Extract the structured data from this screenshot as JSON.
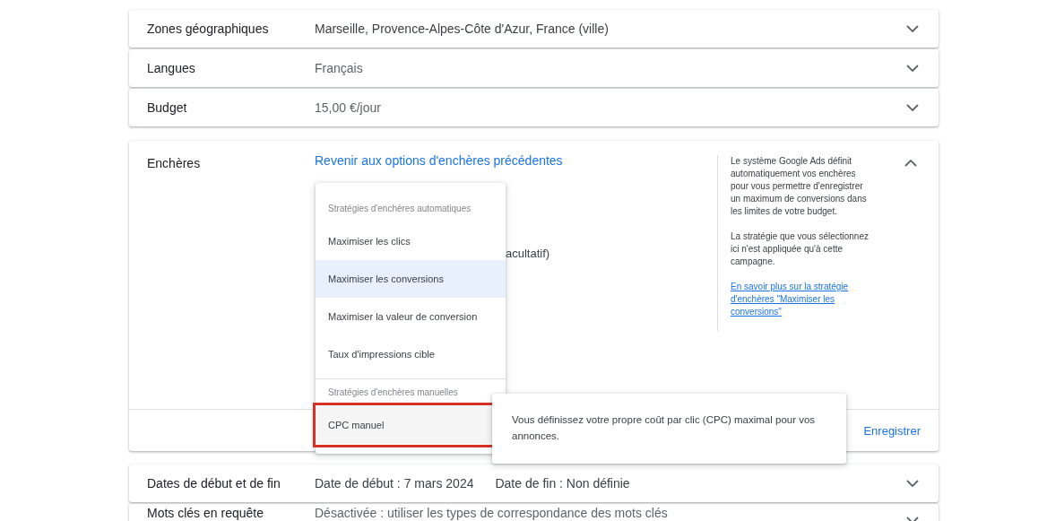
{
  "sections": [
    {
      "label": "Zones géographiques",
      "values": [
        "Marseille, Provence-Alpes-Côte d'Azur, France (ville)"
      ],
      "muted": false,
      "expanded": false
    },
    {
      "label": "Langues",
      "values": [
        "Français"
      ],
      "muted": true,
      "expanded": false
    },
    {
      "label": "Budget",
      "values": [
        "15,00 €/jour"
      ],
      "muted": true,
      "expanded": false
    }
  ],
  "bidding": {
    "label": "Enchères",
    "back_link": "Revenir aux options d'enchères précédentes",
    "partial_text": "acultatif)",
    "expanded": true,
    "help": {
      "paragraphs": [
        "Le système Google Ads définit automatiquement vos enchères pour vous permettre d'enregistrer un maximum de conversions dans les limites de votre budget.",
        "La stratégie que vous sélectionnez ici n'est appliquée qu'à cette campagne."
      ],
      "link": "En savoir plus sur la stratégie d'enchères \"Maximiser les conversions\""
    },
    "save_button": "Enregistrer",
    "menu": [
      {
        "kind": "header",
        "label": "Stratégies d'enchères automatiques"
      },
      {
        "kind": "option",
        "label": "Maximiser les clics",
        "selected": false,
        "highlighted": false
      },
      {
        "kind": "option",
        "label": "Maximiser les conversions",
        "selected": true,
        "highlighted": false
      },
      {
        "kind": "option",
        "label": "Maximiser la valeur de conversion",
        "selected": false,
        "highlighted": false
      },
      {
        "kind": "option",
        "label": "Taux d'impressions cible",
        "selected": false,
        "highlighted": false
      },
      {
        "kind": "divider"
      },
      {
        "kind": "header",
        "label": "Stratégies d'enchères manuelles"
      },
      {
        "kind": "option",
        "label": "CPC manuel",
        "selected": false,
        "highlighted": true
      }
    ],
    "tooltip": "Vous définissez votre propre coût par clic (CPC) maximal pour vos annonces."
  },
  "sections_after": [
    {
      "label": "Dates de début et de fin",
      "values": [
        "Date de début : 7 mars 2024",
        "Date de fin : Non définie"
      ],
      "muted": false,
      "expanded": false
    },
    {
      "label": "Mots clés en requête",
      "values": [
        "Désactivée : utiliser les types de correspondance des mots clés"
      ],
      "muted": true,
      "expanded": false
    }
  ]
}
